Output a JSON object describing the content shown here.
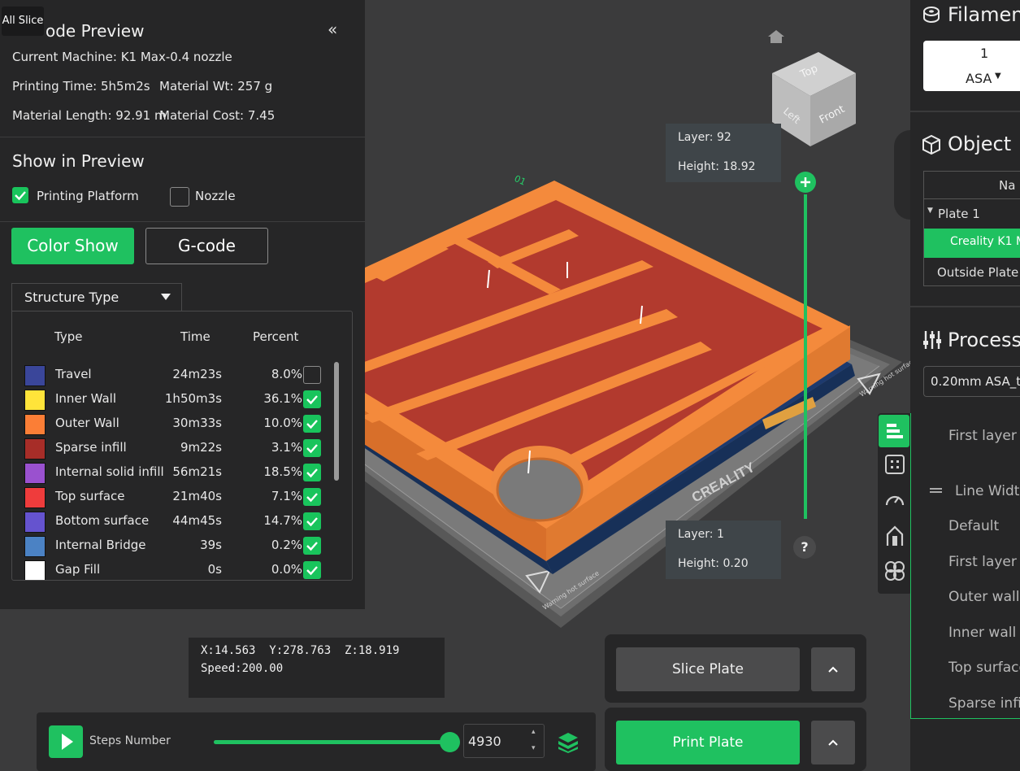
{
  "tab": {
    "all_slice": "All Slice"
  },
  "gcode_preview": {
    "title_visible": "ode Preview",
    "collapse_glyph": "«",
    "current_machine": "Current Machine: K1 Max-0.4 nozzle",
    "printing_time": "Printing Time: 5h5m2s",
    "material_wt": "Material Wt: 257 g",
    "material_length": "Material Length: 92.91 m",
    "material_cost": "Material Cost: 7.45"
  },
  "show_in_preview": {
    "title": "Show in Preview",
    "printing_platform": {
      "label": "Printing Platform",
      "checked": true
    },
    "nozzle": {
      "label": "Nozzle",
      "checked": false
    }
  },
  "buttons": {
    "color_show": "Color Show",
    "gcode": "G-code"
  },
  "structure_dropdown": {
    "selected": "Structure Type"
  },
  "legend": {
    "headers": {
      "type": "Type",
      "time": "Time",
      "percent": "Percent"
    },
    "rows": [
      {
        "name": "Travel",
        "time": "24m23s",
        "percent": "8.0%",
        "color": "#3a469a",
        "checked": false
      },
      {
        "name": "Inner Wall",
        "time": "1h50m3s",
        "percent": "36.1%",
        "color": "#ffe43a",
        "checked": true
      },
      {
        "name": "Outer Wall",
        "time": "30m33s",
        "percent": "10.0%",
        "color": "#fb7e36",
        "checked": true
      },
      {
        "name": "Sparse infill",
        "time": "9m22s",
        "percent": "3.1%",
        "color": "#a72d28",
        "checked": true
      },
      {
        "name": "Internal solid infill",
        "time": "56m21s",
        "percent": "18.5%",
        "color": "#9a51cf",
        "checked": true
      },
      {
        "name": "Top surface",
        "time": "21m40s",
        "percent": "7.1%",
        "color": "#ef3c3c",
        "checked": true
      },
      {
        "name": "Bottom surface",
        "time": "44m45s",
        "percent": "14.7%",
        "color": "#6553cf",
        "checked": true
      },
      {
        "name": "Internal Bridge",
        "time": "39s",
        "percent": "0.2%",
        "color": "#4b82c4",
        "checked": true
      },
      {
        "name": "Gap Fill",
        "time": "0s",
        "percent": "0.0%",
        "color": "#ffffff",
        "checked": true
      }
    ]
  },
  "layer_top": {
    "layer": "Layer: 92",
    "height": "Height: 18.92"
  },
  "layer_bottom": {
    "layer": "Layer: 1",
    "height": "Height: 0.20"
  },
  "layer_slider_level": 1.0,
  "help_glyph": "?",
  "view_cube": {
    "top": "Top",
    "left": "Left",
    "front": "Front"
  },
  "plate": {
    "brand": "CREALITY",
    "warning": "Warning hot surface",
    "plate_number": "01"
  },
  "coords": {
    "position": "X:14.563  Y:278.763  Z:18.919",
    "speed": "Speed:200.00"
  },
  "steps": {
    "label": "Steps Number",
    "value": "4930",
    "slider_level": 1.0
  },
  "actions": {
    "slice_plate": "Slice Plate",
    "print_plate": "Print Plate"
  },
  "right_panel": {
    "filament_title": "Filamen",
    "filament_slot": "1",
    "filament_type": "ASA",
    "object_title": "Object",
    "object_column": "Na",
    "plate_item": "Plate 1",
    "object_item": "Creality K1 M",
    "outside_plate": "Outside Plate",
    "process_title": "Process",
    "process_preset": "0.20mm ASA_t",
    "settings": [
      "First layer h",
      "Line Width",
      "Default",
      "First layer",
      "Outer wall",
      "Inner wall",
      "Top surface",
      "Sparse infil"
    ]
  },
  "colors": {
    "accent": "#1fc160",
    "panel": "#262627",
    "viewport": "#3b3b3c"
  }
}
